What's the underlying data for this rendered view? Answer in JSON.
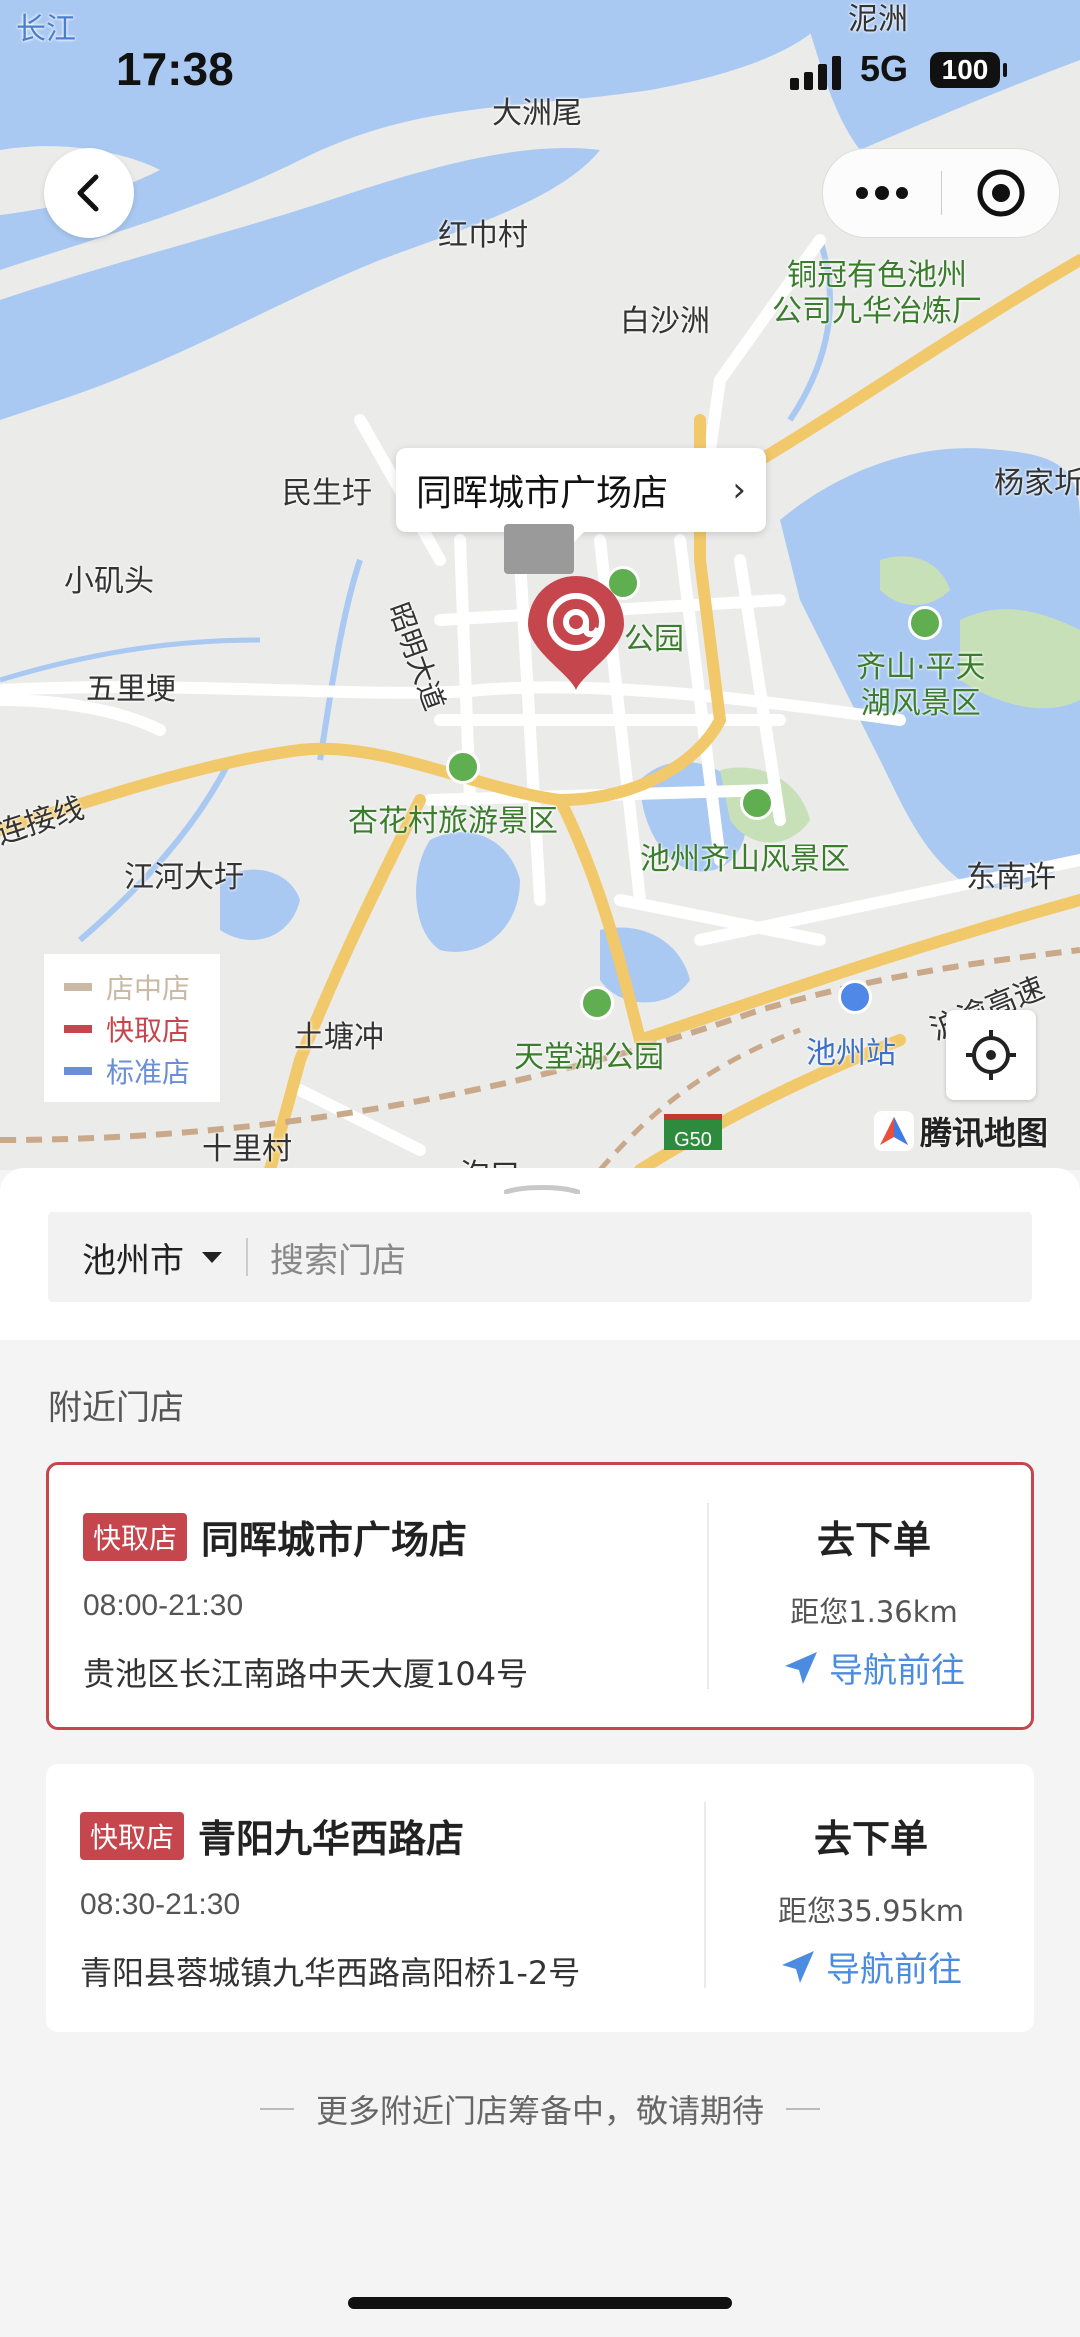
{
  "status_bar": {
    "time": "17:38",
    "network": "5G",
    "battery": "100"
  },
  "map": {
    "labels": {
      "changjiang": "长江",
      "nizhou": "泥洲",
      "dazhouwei": "大洲尾",
      "hongshicun": "红巾村",
      "baishazhou": "白沙洲",
      "tongguan": "铜冠有色池州\n公司九华冶炼厂",
      "minshengyu": "民生圩",
      "xiaojitou": "小矶头",
      "wulitan": "五里埂",
      "zhaomingdadao": "昭明大道",
      "gongyuan": "公园",
      "qishan_pingtian": "齐山·平天\n湖风景区",
      "xinghuacun": "杏花村旅游景区",
      "lianjiexian": "连接线",
      "jianghedayu": "江河大圩",
      "qishan_fengjing": "池州齐山风景区",
      "dongnanxu": "东南许",
      "yangjia": "杨家圻",
      "tutangchong": "土塘冲",
      "tiantanghu": "天堂湖公园",
      "chizhouzhan": "池州站",
      "huyu": "沪渝高速",
      "shilicun": "十里村",
      "road_g50": "G50",
      "gukou": "沟口"
    },
    "callout_store": "同晖城市广场店",
    "legend": [
      {
        "label": "店中店",
        "color": "#c9b9a5"
      },
      {
        "label": "快取店",
        "color": "#c5474d"
      },
      {
        "label": "标准店",
        "color": "#6a8fd6"
      }
    ],
    "provider": "腾讯地图"
  },
  "search": {
    "city": "池州市",
    "placeholder": "搜索门店"
  },
  "section_title": "附近门店",
  "stores": [
    {
      "badge": "快取店",
      "name": "同晖城市广场店",
      "hours": "08:00-21:30",
      "address": "贵池区长江南路中天大厦104号",
      "order_label": "去下单",
      "distance": "距您1.36km",
      "nav_label": "导航前往"
    },
    {
      "badge": "快取店",
      "name": "青阳九华西路店",
      "hours": "08:30-21:30",
      "address": "青阳县蓉城镇九华西路高阳桥1-2号",
      "order_label": "去下单",
      "distance": "距您35.95km",
      "nav_label": "导航前往"
    }
  ],
  "footer_note": "更多附近门店筹备中，敬请期待"
}
